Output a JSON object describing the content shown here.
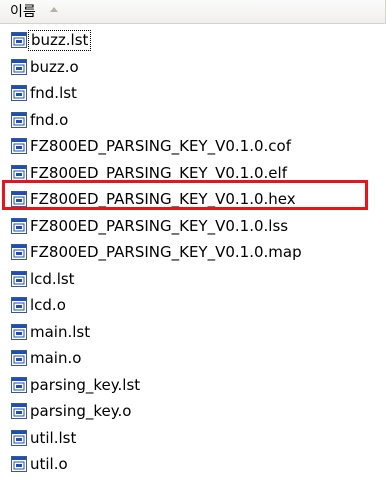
{
  "header": {
    "name_column_label": "이름",
    "sort_indicator": "sort-ascending-icon"
  },
  "files": [
    {
      "name": "buzz.lst"
    },
    {
      "name": "buzz.o"
    },
    {
      "name": "fnd.lst"
    },
    {
      "name": "fnd.o"
    },
    {
      "name": "FZ800ED_PARSING_KEY_V0.1.0.cof"
    },
    {
      "name": "FZ800ED_PARSING_KEY_V0.1.0.elf"
    },
    {
      "name": "FZ800ED_PARSING_KEY_V0.1.0.hex"
    },
    {
      "name": "FZ800ED_PARSING_KEY_V0.1.0.lss"
    },
    {
      "name": "FZ800ED_PARSING_KEY_V0.1.0.map"
    },
    {
      "name": "lcd.lst"
    },
    {
      "name": "lcd.o"
    },
    {
      "name": "main.lst"
    },
    {
      "name": "main.o"
    },
    {
      "name": "parsing_key.lst"
    },
    {
      "name": "parsing_key.o"
    },
    {
      "name": "util.lst"
    },
    {
      "name": "util.o"
    }
  ],
  "focused_file": "buzz.lst",
  "highlighted_file": "FZ800ED_PARSING_KEY_V0.1.0.hex",
  "colors": {
    "highlight_border": "#e8141b",
    "icon_blue": "#1f4fb5",
    "icon_border": "#3a5a8c"
  }
}
